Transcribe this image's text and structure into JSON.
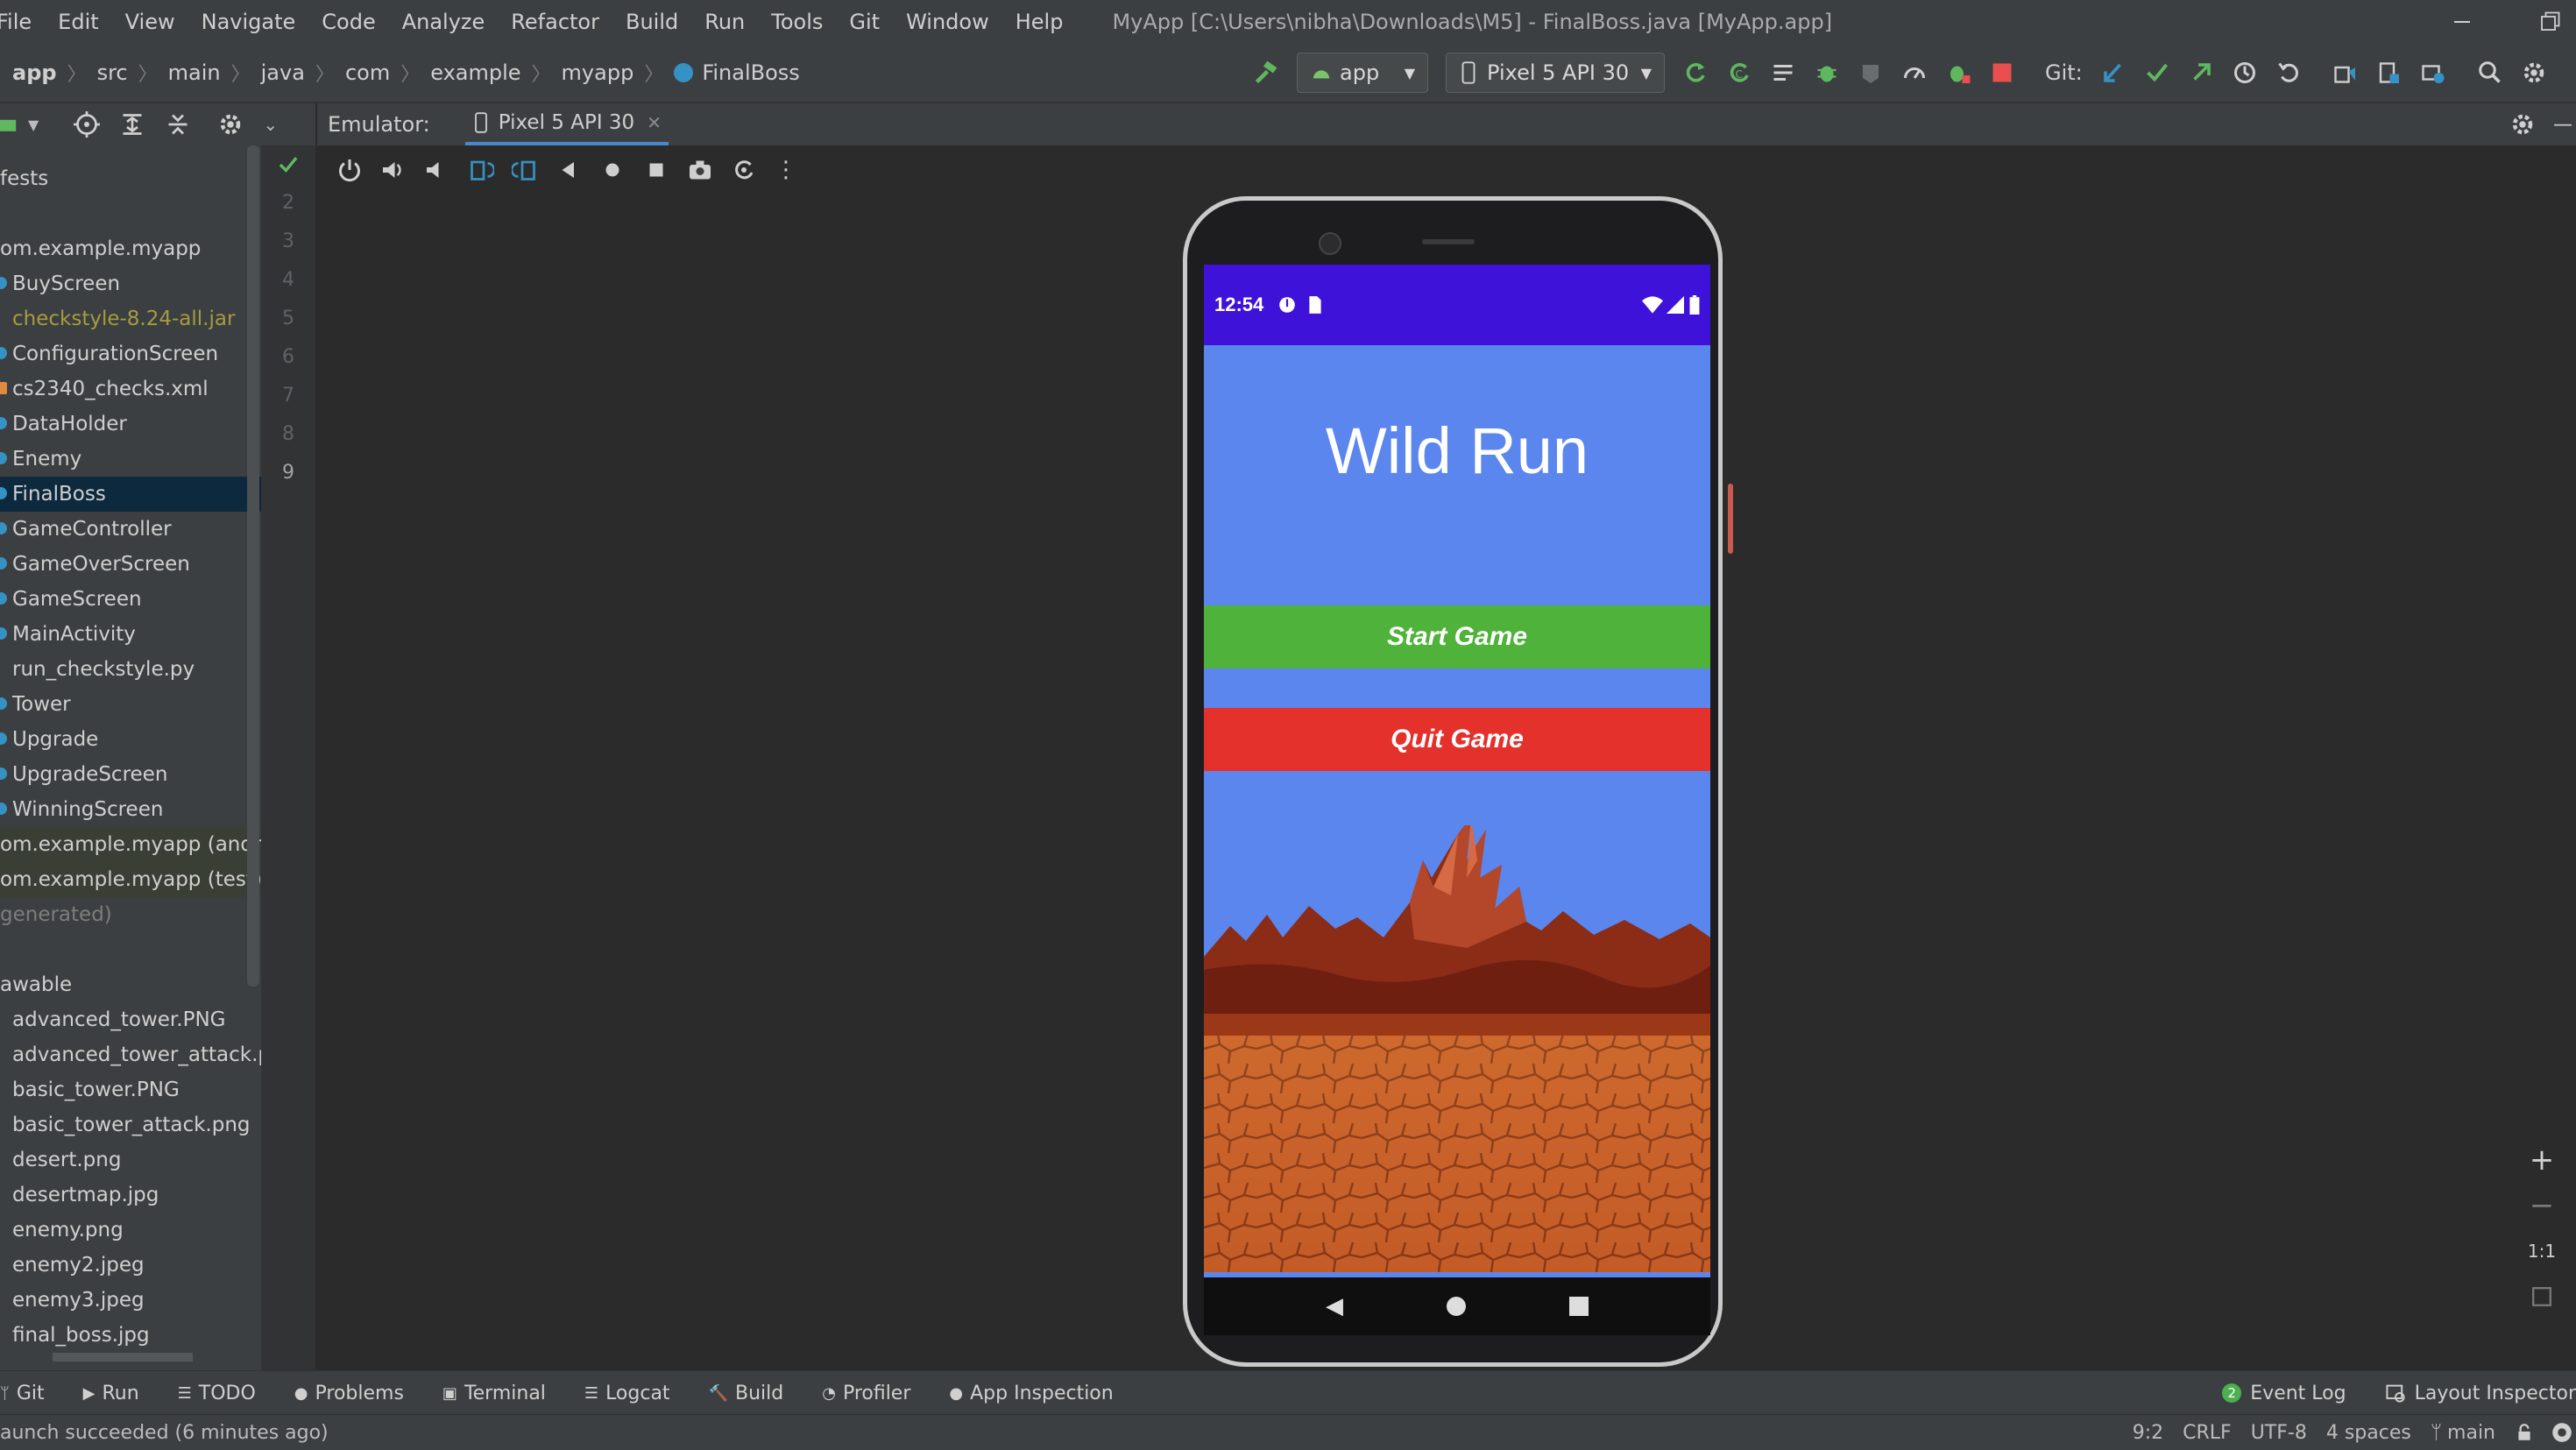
{
  "menu": {
    "items": [
      "File",
      "Edit",
      "View",
      "Navigate",
      "Code",
      "Analyze",
      "Refactor",
      "Build",
      "Run",
      "Tools",
      "Git",
      "Window",
      "Help"
    ],
    "window_title": "MyApp [C:\\Users\\nibha\\Downloads\\M5] - FinalBoss.java [MyApp.app]"
  },
  "breadcrumb": [
    "app",
    "src",
    "main",
    "java",
    "com",
    "example",
    "myapp",
    "FinalBoss"
  ],
  "toolbar": {
    "run_config": "app",
    "device": "Pixel 5 API 30",
    "git_label": "Git:"
  },
  "emulator": {
    "label": "Emulator:",
    "tab": "Pixel 5 API 30"
  },
  "project_tree": [
    {
      "label": "fests",
      "kind": "pkg"
    },
    {
      "label": "",
      "kind": "spacer"
    },
    {
      "label": "om.example.myapp",
      "kind": "pkg"
    },
    {
      "label": "BuyScreen",
      "kind": "class"
    },
    {
      "label": "checkstyle-8.24-all.jar",
      "kind": "jar"
    },
    {
      "label": "ConfigurationScreen",
      "kind": "class"
    },
    {
      "label": "cs2340_checks.xml",
      "kind": "xml"
    },
    {
      "label": "DataHolder",
      "kind": "class"
    },
    {
      "label": "Enemy",
      "kind": "class"
    },
    {
      "label": "FinalBoss",
      "kind": "class",
      "selected": true
    },
    {
      "label": "GameController",
      "kind": "class"
    },
    {
      "label": "GameOverScreen",
      "kind": "class"
    },
    {
      "label": "GameScreen",
      "kind": "class"
    },
    {
      "label": "MainActivity",
      "kind": "class"
    },
    {
      "label": "run_checkstyle.py",
      "kind": "file"
    },
    {
      "label": "Tower",
      "kind": "class"
    },
    {
      "label": "Upgrade",
      "kind": "class"
    },
    {
      "label": "UpgradeScreen",
      "kind": "class"
    },
    {
      "label": "WinningScreen",
      "kind": "class"
    },
    {
      "label": "om.example.myapp (androi",
      "kind": "gen"
    },
    {
      "label": "om.example.myapp (test)",
      "kind": "gen"
    },
    {
      "label": "generated)",
      "kind": "dim"
    },
    {
      "label": "",
      "kind": "spacer"
    },
    {
      "label": "awable",
      "kind": "pkg"
    },
    {
      "label": "advanced_tower.PNG",
      "kind": "file"
    },
    {
      "label": "advanced_tower_attack.pn",
      "kind": "file"
    },
    {
      "label": "basic_tower.PNG",
      "kind": "file"
    },
    {
      "label": "basic_tower_attack.png",
      "kind": "file"
    },
    {
      "label": "desert.png",
      "kind": "file"
    },
    {
      "label": "desertmap.jpg",
      "kind": "file"
    },
    {
      "label": "enemy.png",
      "kind": "file"
    },
    {
      "label": "enemy2.jpeg",
      "kind": "file"
    },
    {
      "label": "enemy3.jpeg",
      "kind": "file"
    },
    {
      "label": "final_boss.jpg",
      "kind": "file"
    }
  ],
  "line_numbers": [
    "2",
    "3",
    "4",
    "5",
    "6",
    "7",
    "8",
    "9"
  ],
  "phone": {
    "time": "12:54",
    "app_title": "Wild Run",
    "start_button": "Start Game",
    "quit_button": "Quit Game",
    "colors": {
      "status": "#3f12d9",
      "bg": "#5b86ed",
      "start": "#4fb23a",
      "quit": "#e4312b"
    }
  },
  "tool_windows": [
    "Git",
    "Run",
    "TODO",
    "Problems",
    "Terminal",
    "Logcat",
    "Build",
    "Profiler",
    "App Inspection"
  ],
  "tool_windows_right": [
    "Event Log",
    "Layout Inspector"
  ],
  "event_log_count": "2",
  "status": {
    "message": "aunch succeeded (6 minutes ago)",
    "position": "9:2",
    "line_sep": "CRLF",
    "encoding": "UTF-8",
    "indent": "4 spaces",
    "branch": "main"
  },
  "zoom_controls": [
    "+",
    "−",
    "1:1"
  ]
}
